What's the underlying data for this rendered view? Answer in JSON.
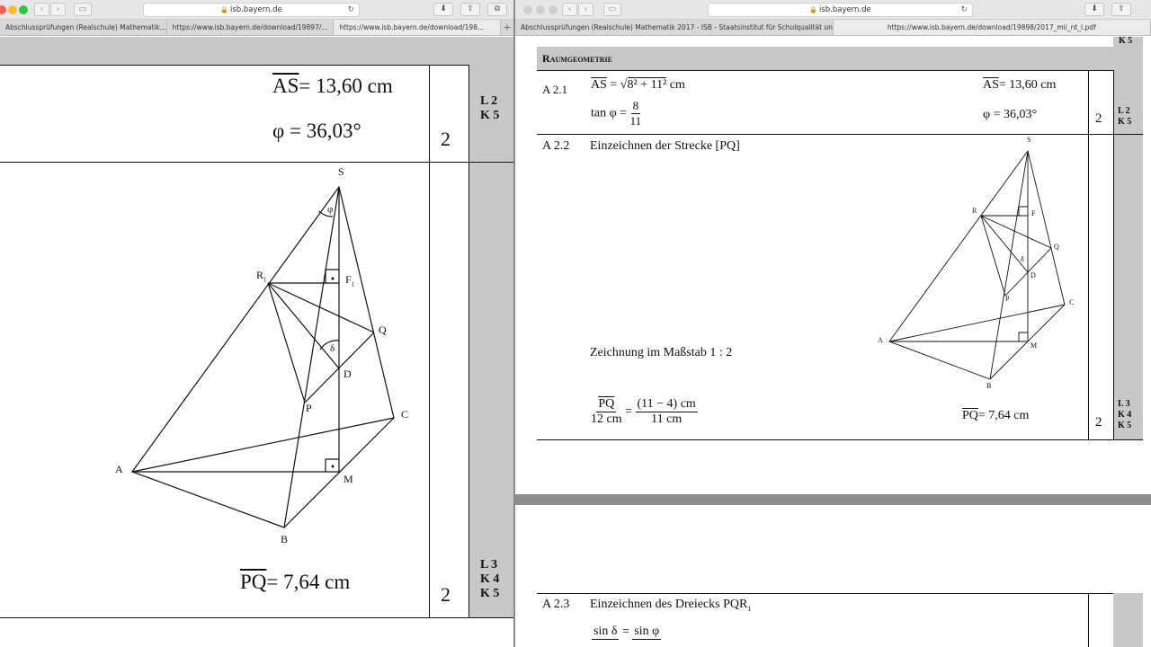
{
  "left_window": {
    "url": "isb.bayern.de",
    "tabs": [
      {
        "label": "Abschlussprüfungen (Realschule) Mathematik...",
        "active": false
      },
      {
        "label": "https://www.isb.bayern.de/download/19897/...",
        "active": false
      },
      {
        "label": "https://www.isb.bayern.de/download/198...",
        "active": true
      }
    ],
    "row1": {
      "as_label": "AS",
      "as_value": "= 13,60 cm",
      "phi_value": "φ = 36,03°",
      "points": "2",
      "codes": [
        "L 2",
        "K 5"
      ]
    },
    "figure_labels": {
      "S": "S",
      "phi": "φ",
      "R": "R",
      "R_sub": "1",
      "F": "F",
      "F_sub": "1",
      "Q": "Q",
      "delta": "δ",
      "D": "D",
      "P": "P",
      "C": "C",
      "A": "A",
      "M": "M",
      "B": "B"
    },
    "row2": {
      "pq_label": "PQ",
      "pq_value": "= 7,64 cm",
      "points": "2",
      "codes": [
        "L 3",
        "K 4",
        "K 5"
      ]
    }
  },
  "right_window": {
    "url": "isb.bayern.de",
    "tabs": [
      {
        "label": "Abschlussprüfungen (Realschule) Mathematik 2017 - ISB - Staatsinstitut für Schulqualität un...",
        "active": false
      },
      {
        "label": "https://www.isb.bayern.de/download/19898/2017_mii_nt_l.pdf",
        "active": true
      }
    ],
    "top_code": "K 5",
    "section_title": "Raumgeometrie",
    "a21": {
      "id": "A 2.1",
      "as_label": "AS",
      "sqrt_text": "8² + 11²",
      "unit": "cm",
      "tan_text": "tan φ =",
      "tan_num": "8",
      "tan_den": "11",
      "result_as_value": "= 13,60 cm",
      "result_phi": "φ = 36,03°",
      "points": "2",
      "codes": [
        "L 2",
        "K 5"
      ]
    },
    "a22": {
      "id": "A 2.2",
      "title": "Einzeichnen der Strecke [PQ]",
      "scale_text": "Zeichnung im Maßstab 1 : 2",
      "frac1_num": "PQ",
      "frac1_den": "12 cm",
      "frac2_num": "(11 − 4) cm",
      "frac2_den": "11 cm",
      "result_pq_value": "= 7,64 cm",
      "points": "2",
      "codes": [
        "L 3",
        "K 4",
        "K 5"
      ]
    },
    "a23": {
      "id": "A 2.3",
      "title": "Einzeichnen des Dreiecks PQR",
      "title_sub": "1",
      "sin_left": "sin δ",
      "sin_right": "sin φ"
    }
  },
  "colors": {
    "rating_gray": "#c8c8c8",
    "divider_gray": "#8a8a8a",
    "page_gap_gray": "#8e8e8e"
  }
}
